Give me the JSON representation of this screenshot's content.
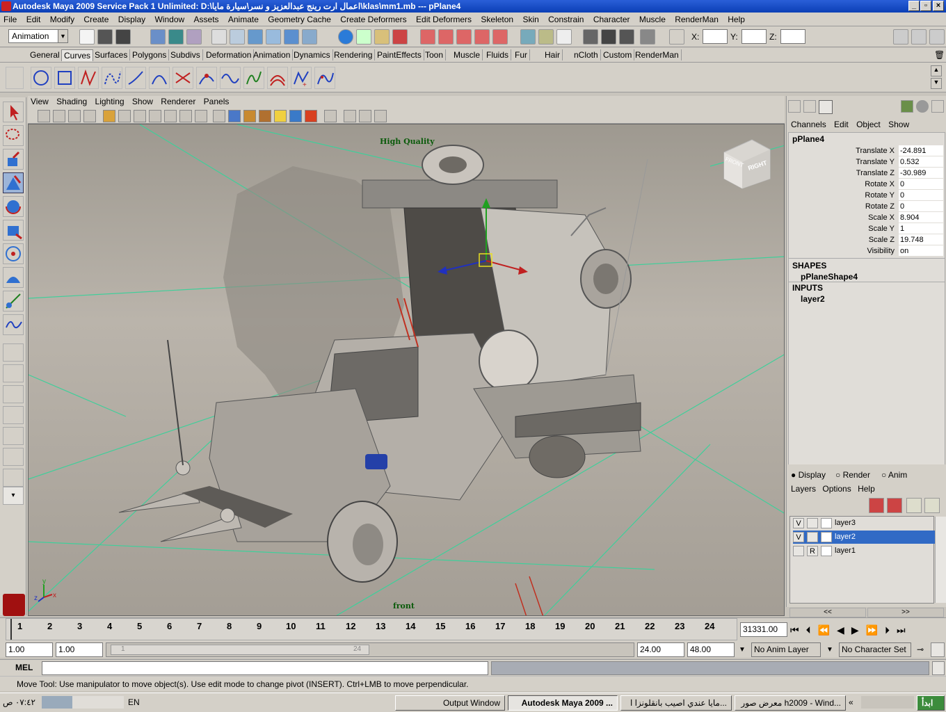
{
  "window": {
    "title": "Autodesk Maya 2009 Service Pack 1 Unlimited: D:\\اعمال ارت رينج عبدالعزيز و نسر\\سيارة مايا\\klas\\mm1.mb   ---   pPlane4",
    "minimize": "_",
    "maximize": "▫",
    "close": "×"
  },
  "menubar": [
    "File",
    "Edit",
    "Modify",
    "Create",
    "Display",
    "Window",
    "Assets",
    "Animate",
    "Geometry Cache",
    "Create Deformers",
    "Edit Deformers",
    "Skeleton",
    "Skin",
    "Constrain",
    "Character",
    "Muscle",
    "RenderMan",
    "Help"
  ],
  "status": {
    "menu_set": "Animation",
    "x_label": "X:",
    "y_label": "Y:",
    "z_label": "Z:"
  },
  "shelf_tabs": [
    "General",
    "Curves",
    "Surfaces",
    "Polygons",
    "Subdivs",
    "Deformation",
    "Animation",
    "Dynamics",
    "Rendering",
    "PaintEffects",
    "Toon",
    "Muscle",
    "Fluids",
    "Fur",
    "Hair",
    "nCloth",
    "Custom",
    "RenderMan"
  ],
  "shelf_active": "Curves",
  "viewport": {
    "menu": [
      "View",
      "Shading",
      "Lighting",
      "Show",
      "Renderer",
      "Panels"
    ],
    "hud_quality": "High Quality",
    "camera_name": "front",
    "viewcube_front": "FRONT",
    "viewcube_right": "RIGHT",
    "axis_x": "x",
    "axis_y": "y",
    "axis_z": "z"
  },
  "channels": {
    "menu": [
      "Channels",
      "Edit",
      "Object",
      "Show"
    ],
    "object": "pPlane4",
    "attrs": [
      {
        "name": "Translate X",
        "value": "-24.891"
      },
      {
        "name": "Translate Y",
        "value": "0.532"
      },
      {
        "name": "Translate Z",
        "value": "-30.989"
      },
      {
        "name": "Rotate X",
        "value": "0"
      },
      {
        "name": "Rotate Y",
        "value": "0"
      },
      {
        "name": "Rotate Z",
        "value": "0"
      },
      {
        "name": "Scale X",
        "value": "8.904"
      },
      {
        "name": "Scale Y",
        "value": "1"
      },
      {
        "name": "Scale Z",
        "value": "19.748"
      },
      {
        "name": "Visibility",
        "value": "on"
      }
    ],
    "shapes_header": "SHAPES",
    "shape": "pPlaneShape4",
    "inputs_header": "INPUTS",
    "input": "layer2"
  },
  "layers": {
    "modes": [
      "Display",
      "Render",
      "Anim"
    ],
    "selected_mode": "Display",
    "menu": [
      "Layers",
      "Options",
      "Help"
    ],
    "rows": [
      {
        "v": "V",
        "t": "",
        "name": "layer3",
        "selected": false
      },
      {
        "v": "V",
        "t": "",
        "name": "layer2",
        "selected": true
      },
      {
        "v": "",
        "t": "R",
        "name": "layer1",
        "selected": false
      }
    ],
    "scroll_left": "<<",
    "scroll_right": ">>"
  },
  "timeline": {
    "ticks": [
      "1",
      "2",
      "3",
      "4",
      "5",
      "6",
      "7",
      "8",
      "9",
      "10",
      "11",
      "12",
      "13",
      "14",
      "15",
      "16",
      "17",
      "18",
      "19",
      "20",
      "21",
      "22",
      "23",
      "24"
    ],
    "current_time": "31331.00"
  },
  "range": {
    "start": "1.00",
    "playback_start": "1.00",
    "slider_left": "1",
    "slider_right": "24",
    "playback_end": "24.00",
    "end": "48.00",
    "anim_layer": "No Anim Layer",
    "character_set": "No Character Set"
  },
  "mel": {
    "label": "MEL"
  },
  "help_line": "Move Tool: Use manipulator to move object(s). Use edit mode to change pivot (INSERT).  Ctrl+LMB to move perpendicular.",
  "taskbar": {
    "clock": "٠٧:٤٢ ص",
    "lang": "EN",
    "tasks": [
      {
        "label": "Output Window",
        "active": false
      },
      {
        "label": "Autodesk Maya 2009 ...",
        "active": true
      },
      {
        "label": "مايا عندي اصيب بانقلونزا ا...",
        "active": false
      },
      {
        "label": "معرض صور h2009 - Wind...",
        "active": false
      }
    ],
    "start": "ابدأ"
  },
  "colors": {
    "title_blue": "#0b3fb5",
    "grid_green": "#3fcf9a",
    "layer_selected": "#316ac5",
    "hud_green": "#0a5a0a"
  }
}
